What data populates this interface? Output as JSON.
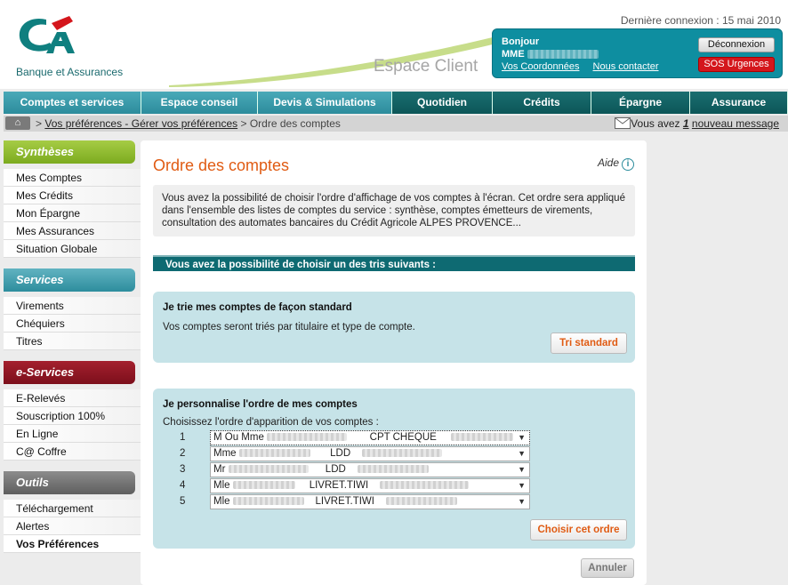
{
  "header": {
    "brand_subtitle": "Banque et Assurances",
    "espace_client": "Espace Client",
    "last_connection": "Dernière connexion : 15 mai 2010",
    "greeting": "Bonjour",
    "user_title": "MME",
    "link_coords": "Vos Coordonnées",
    "link_contact": "Nous contacter",
    "logout": "Déconnexion",
    "sos": "SOS Urgences"
  },
  "nav": {
    "items": [
      {
        "label": "Comptes et services"
      },
      {
        "label": "Espace conseil"
      },
      {
        "label": "Devis & Simulations"
      },
      {
        "label": "Quotidien"
      },
      {
        "label": "Crédits"
      },
      {
        "label": "Épargne"
      },
      {
        "label": "Assurance"
      }
    ]
  },
  "breadcrumb": {
    "sep1": ">",
    "link": "Vos préférences - Gérer vos préférences",
    "sep2": ">",
    "current": "Ordre des comptes",
    "msg_prefix": "Vous avez",
    "msg_count": "1",
    "msg_suffix": "nouveau message"
  },
  "sidebar": {
    "syntheses": {
      "title": "Synthèses",
      "items": [
        "Mes Comptes",
        "Mes Crédits",
        "Mon Épargne",
        "Mes Assurances",
        "Situation Globale"
      ]
    },
    "services": {
      "title": "Services",
      "items": [
        "Virements",
        "Chéquiers",
        "Titres"
      ]
    },
    "eservices": {
      "title": "e-Services",
      "items": [
        "E-Relevés",
        "Souscription 100%",
        "En Ligne",
        "C@ Coffre"
      ]
    },
    "outils": {
      "title": "Outils",
      "items": [
        "Téléchargement",
        "Alertes",
        "Vos Préférences"
      ]
    }
  },
  "main": {
    "title": "Ordre des comptes",
    "aide": "Aide",
    "intro": "Vous avez la possibilité de choisir l'ordre d'affichage de vos comptes à l'écran. Cet ordre sera appliqué dans l'ensemble des listes de comptes du service : synthèse, comptes émetteurs de virements, consultation des automates bancaires du Crédit Agricole ALPES PROVENCE...",
    "band": "Vous avez la possibilité de choisir un des tris suivants :",
    "standard": {
      "title": "Je trie mes comptes de façon standard",
      "text": "Vos comptes seront triés par titulaire et type de compte.",
      "button": "Tri standard"
    },
    "custom": {
      "title": "Je personnalise l'ordre de mes comptes",
      "label": "Choisissez l'ordre d'apparition de vos comptes :",
      "rows": [
        {
          "num": "1",
          "holder": "M Ou Mme",
          "type": "CPT CHEQUE"
        },
        {
          "num": "2",
          "holder": "Mme",
          "type": "LDD"
        },
        {
          "num": "3",
          "holder": "Mr",
          "type": "LDD"
        },
        {
          "num": "4",
          "holder": "Mle",
          "type": "LIVRET.TIWI"
        },
        {
          "num": "5",
          "holder": "Mle",
          "type": "LIVRET.TIWI"
        }
      ],
      "button": "Choisir cet ordre"
    },
    "cancel": "Annuler"
  }
}
